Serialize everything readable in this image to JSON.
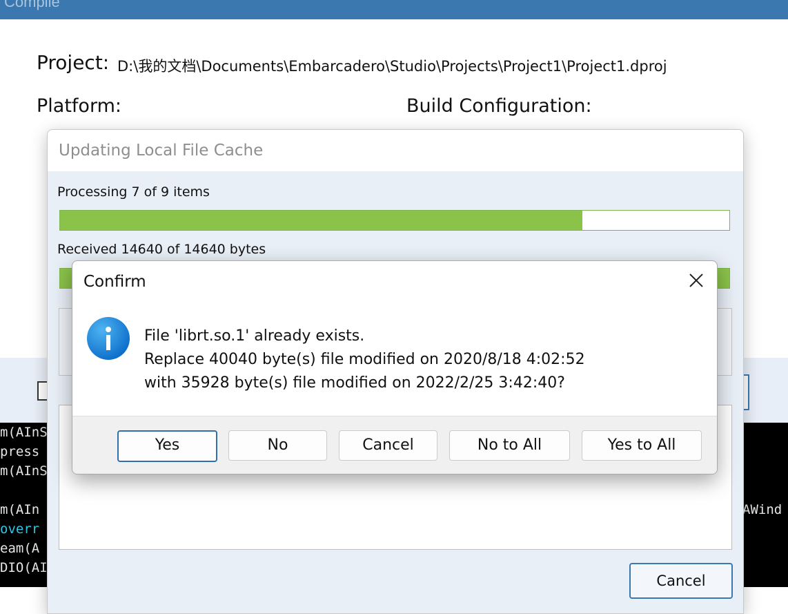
{
  "compile": {
    "title": "Compile",
    "project_label": "Project:",
    "project_path": "D:\\我的文档\\Documents\\Embarcadero\\Studio\\Projects\\Project1\\Project1.dproj",
    "platform_label": "Platform:",
    "build_config_label": "Build Configuration:",
    "terminal_left": [
      "m(AInS",
      "press",
      "m(AInS",
      "",
      "m(AIn",
      "overr",
      "eam(A",
      "DIO(AI"
    ],
    "terminal_right": [
      "",
      "",
      "",
      "",
      "AWind"
    ]
  },
  "update_dialog": {
    "title": "Updating Local File Cache",
    "processing_text": "Processing 7 of 9 items",
    "progress_fraction": 0.78,
    "received_text": "Received 14640 of 14640 bytes",
    "cancel_label": "Cancel"
  },
  "confirm_dialog": {
    "title": "Confirm",
    "message_lines": [
      "File 'librt.so.1' already exists.",
      "Replace 40040 byte(s) file modified on 2020/8/18 4:02:52",
      "with 35928 byte(s) file modified on 2022/2/25 3:42:40?"
    ],
    "buttons": {
      "yes": "Yes",
      "no": "No",
      "cancel": "Cancel",
      "no_to_all": "No to All",
      "yes_to_all": "Yes to All"
    },
    "icon": "info-icon",
    "accent": "#2f6fad"
  }
}
